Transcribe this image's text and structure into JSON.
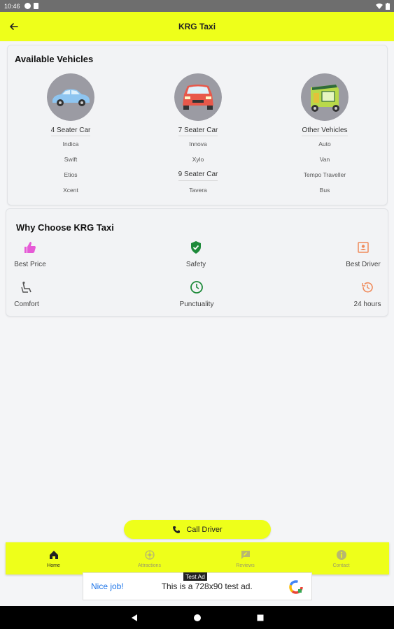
{
  "status_bar": {
    "time": "10:46"
  },
  "app_bar": {
    "title": "KRG Taxi"
  },
  "vehicles": {
    "title": "Available Vehicles",
    "col1": {
      "heading": "4 Seater Car",
      "items": [
        "Indica",
        "Swift",
        "Etios",
        "Xcent"
      ]
    },
    "col2": {
      "heading": "7 Seater Car",
      "items": [
        "Innova",
        "Xylo"
      ],
      "subheading": "9 Seater Car",
      "subitems": [
        "Tavera"
      ]
    },
    "col3": {
      "heading": "Other Vehicles",
      "items": [
        "Auto",
        "Van",
        "Tempo Traveller",
        "Bus"
      ]
    }
  },
  "why": {
    "title": "Why Choose KRG Taxi",
    "features": [
      "Best Price",
      "Safety",
      "Best Driver",
      "Comfort",
      "Punctuality",
      "24 hours"
    ]
  },
  "call_button": {
    "label": "Call Driver"
  },
  "bottom_nav": {
    "items": [
      "Home",
      "Attractions",
      "Reviews",
      "Contact"
    ]
  },
  "ad": {
    "tag": "Test Ad",
    "cta": "Nice job!",
    "message": "This is a 728x90 test ad."
  },
  "colors": {
    "accent": "#eeff1a",
    "background": "#f4f5f7"
  }
}
